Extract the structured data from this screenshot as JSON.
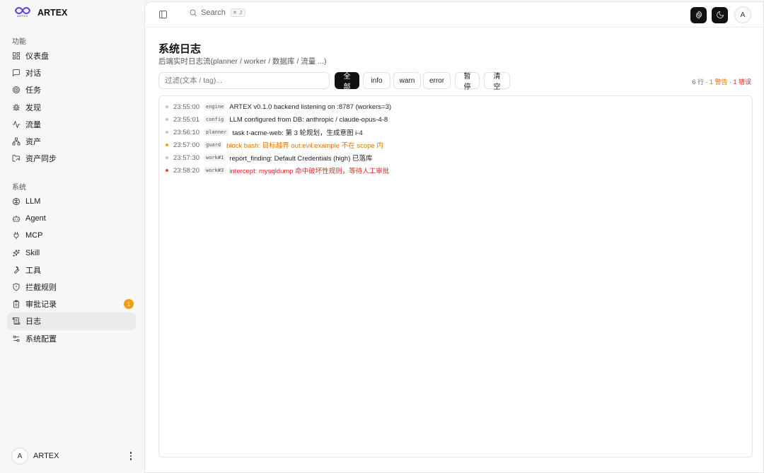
{
  "brand": {
    "name": "ARTEX",
    "logo_text": "ARTEX"
  },
  "sidebar": {
    "section_features": "功能",
    "features": [
      {
        "label": "仪表盘",
        "icon": "dashboard-icon"
      },
      {
        "label": "对话",
        "icon": "chat-icon"
      },
      {
        "label": "任务",
        "icon": "target-icon"
      },
      {
        "label": "发现",
        "icon": "bug-icon"
      },
      {
        "label": "流量",
        "icon": "activity-icon"
      },
      {
        "label": "资产",
        "icon": "network-icon"
      },
      {
        "label": "资产同步",
        "icon": "folder-sync-icon"
      }
    ],
    "section_system": "系统",
    "system": [
      {
        "label": "LLM",
        "icon": "brain-icon"
      },
      {
        "label": "Agent",
        "icon": "bot-icon"
      },
      {
        "label": "MCP",
        "icon": "plug-icon"
      },
      {
        "label": "Skill",
        "icon": "sparkles-icon"
      },
      {
        "label": "工具",
        "icon": "wrench-icon"
      },
      {
        "label": "拦截规则",
        "icon": "shield-icon"
      },
      {
        "label": "审批记录",
        "icon": "clipboard-icon",
        "badge": "1"
      },
      {
        "label": "日志",
        "icon": "logs-icon",
        "active": true
      },
      {
        "label": "系统配置",
        "icon": "settings-sliders-icon"
      }
    ],
    "user": {
      "avatar": "A",
      "name": "ARTEX"
    }
  },
  "topbar": {
    "search_label": "Search",
    "search_shortcut": "⌘ J",
    "avatar": "A"
  },
  "page": {
    "title": "系统日志",
    "subtitle": "后端实时日志流(planner / worker / 数据库 / 流量 ...)"
  },
  "filter": {
    "placeholder": "过滤(文本 / tag)...",
    "value": "",
    "buttons": [
      "全部",
      "info",
      "warn",
      "error",
      "暂停",
      "清空"
    ],
    "active_button": "全部"
  },
  "counts": {
    "rows": "6 行",
    "sep": " · ",
    "warn": "1 警告",
    "error": "1 错误"
  },
  "logs": [
    {
      "time": "23:55:00",
      "tag": "engine",
      "level": "info",
      "message": "ARTEX v0.1.0 backend listening on :8787 (workers=3)"
    },
    {
      "time": "23:55:01",
      "tag": "config",
      "level": "info",
      "message": "LLM configured from DB: anthropic / claude-opus-4-8"
    },
    {
      "time": "23:56:10",
      "tag": "planner",
      "level": "info",
      "message": "task t-acme-web: 第 3 轮规划，生成意图 i-4"
    },
    {
      "time": "23:57:00",
      "tag": "guard",
      "level": "warn",
      "message": "block bash: 目标越界 out.evil.example 不在 scope 内"
    },
    {
      "time": "23:57:30",
      "tag": "work#1",
      "level": "info",
      "message": "report_finding: Default Credentials (high) 已落库"
    },
    {
      "time": "23:58:20",
      "tag": "work#3",
      "level": "error",
      "message": "intercept: mysqldump 命中破坏性规则，等待人工审批"
    }
  ],
  "colors": {
    "warn": "#d97706",
    "error": "#dc2626",
    "badge": "#f59e0b",
    "active_button": "#111111"
  }
}
